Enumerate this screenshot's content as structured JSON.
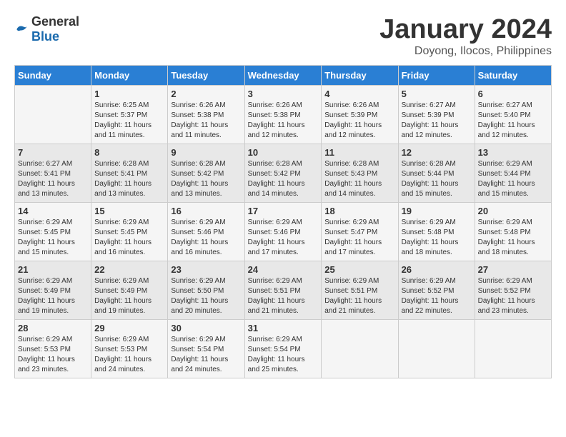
{
  "logo": {
    "general": "General",
    "blue": "Blue"
  },
  "title": "January 2024",
  "location": "Doyong, Ilocos, Philippines",
  "headers": [
    "Sunday",
    "Monday",
    "Tuesday",
    "Wednesday",
    "Thursday",
    "Friday",
    "Saturday"
  ],
  "weeks": [
    [
      {
        "day": "",
        "info": ""
      },
      {
        "day": "1",
        "info": "Sunrise: 6:25 AM\nSunset: 5:37 PM\nDaylight: 11 hours\nand 11 minutes."
      },
      {
        "day": "2",
        "info": "Sunrise: 6:26 AM\nSunset: 5:38 PM\nDaylight: 11 hours\nand 11 minutes."
      },
      {
        "day": "3",
        "info": "Sunrise: 6:26 AM\nSunset: 5:38 PM\nDaylight: 11 hours\nand 12 minutes."
      },
      {
        "day": "4",
        "info": "Sunrise: 6:26 AM\nSunset: 5:39 PM\nDaylight: 11 hours\nand 12 minutes."
      },
      {
        "day": "5",
        "info": "Sunrise: 6:27 AM\nSunset: 5:39 PM\nDaylight: 11 hours\nand 12 minutes."
      },
      {
        "day": "6",
        "info": "Sunrise: 6:27 AM\nSunset: 5:40 PM\nDaylight: 11 hours\nand 12 minutes."
      }
    ],
    [
      {
        "day": "7",
        "info": "Sunrise: 6:27 AM\nSunset: 5:41 PM\nDaylight: 11 hours\nand 13 minutes."
      },
      {
        "day": "8",
        "info": "Sunrise: 6:28 AM\nSunset: 5:41 PM\nDaylight: 11 hours\nand 13 minutes."
      },
      {
        "day": "9",
        "info": "Sunrise: 6:28 AM\nSunset: 5:42 PM\nDaylight: 11 hours\nand 13 minutes."
      },
      {
        "day": "10",
        "info": "Sunrise: 6:28 AM\nSunset: 5:42 PM\nDaylight: 11 hours\nand 14 minutes."
      },
      {
        "day": "11",
        "info": "Sunrise: 6:28 AM\nSunset: 5:43 PM\nDaylight: 11 hours\nand 14 minutes."
      },
      {
        "day": "12",
        "info": "Sunrise: 6:28 AM\nSunset: 5:44 PM\nDaylight: 11 hours\nand 15 minutes."
      },
      {
        "day": "13",
        "info": "Sunrise: 6:29 AM\nSunset: 5:44 PM\nDaylight: 11 hours\nand 15 minutes."
      }
    ],
    [
      {
        "day": "14",
        "info": "Sunrise: 6:29 AM\nSunset: 5:45 PM\nDaylight: 11 hours\nand 15 minutes."
      },
      {
        "day": "15",
        "info": "Sunrise: 6:29 AM\nSunset: 5:45 PM\nDaylight: 11 hours\nand 16 minutes."
      },
      {
        "day": "16",
        "info": "Sunrise: 6:29 AM\nSunset: 5:46 PM\nDaylight: 11 hours\nand 16 minutes."
      },
      {
        "day": "17",
        "info": "Sunrise: 6:29 AM\nSunset: 5:46 PM\nDaylight: 11 hours\nand 17 minutes."
      },
      {
        "day": "18",
        "info": "Sunrise: 6:29 AM\nSunset: 5:47 PM\nDaylight: 11 hours\nand 17 minutes."
      },
      {
        "day": "19",
        "info": "Sunrise: 6:29 AM\nSunset: 5:48 PM\nDaylight: 11 hours\nand 18 minutes."
      },
      {
        "day": "20",
        "info": "Sunrise: 6:29 AM\nSunset: 5:48 PM\nDaylight: 11 hours\nand 18 minutes."
      }
    ],
    [
      {
        "day": "21",
        "info": "Sunrise: 6:29 AM\nSunset: 5:49 PM\nDaylight: 11 hours\nand 19 minutes."
      },
      {
        "day": "22",
        "info": "Sunrise: 6:29 AM\nSunset: 5:49 PM\nDaylight: 11 hours\nand 19 minutes."
      },
      {
        "day": "23",
        "info": "Sunrise: 6:29 AM\nSunset: 5:50 PM\nDaylight: 11 hours\nand 20 minutes."
      },
      {
        "day": "24",
        "info": "Sunrise: 6:29 AM\nSunset: 5:51 PM\nDaylight: 11 hours\nand 21 minutes."
      },
      {
        "day": "25",
        "info": "Sunrise: 6:29 AM\nSunset: 5:51 PM\nDaylight: 11 hours\nand 21 minutes."
      },
      {
        "day": "26",
        "info": "Sunrise: 6:29 AM\nSunset: 5:52 PM\nDaylight: 11 hours\nand 22 minutes."
      },
      {
        "day": "27",
        "info": "Sunrise: 6:29 AM\nSunset: 5:52 PM\nDaylight: 11 hours\nand 23 minutes."
      }
    ],
    [
      {
        "day": "28",
        "info": "Sunrise: 6:29 AM\nSunset: 5:53 PM\nDaylight: 11 hours\nand 23 minutes."
      },
      {
        "day": "29",
        "info": "Sunrise: 6:29 AM\nSunset: 5:53 PM\nDaylight: 11 hours\nand 24 minutes."
      },
      {
        "day": "30",
        "info": "Sunrise: 6:29 AM\nSunset: 5:54 PM\nDaylight: 11 hours\nand 24 minutes."
      },
      {
        "day": "31",
        "info": "Sunrise: 6:29 AM\nSunset: 5:54 PM\nDaylight: 11 hours\nand 25 minutes."
      },
      {
        "day": "",
        "info": ""
      },
      {
        "day": "",
        "info": ""
      },
      {
        "day": "",
        "info": ""
      }
    ]
  ]
}
